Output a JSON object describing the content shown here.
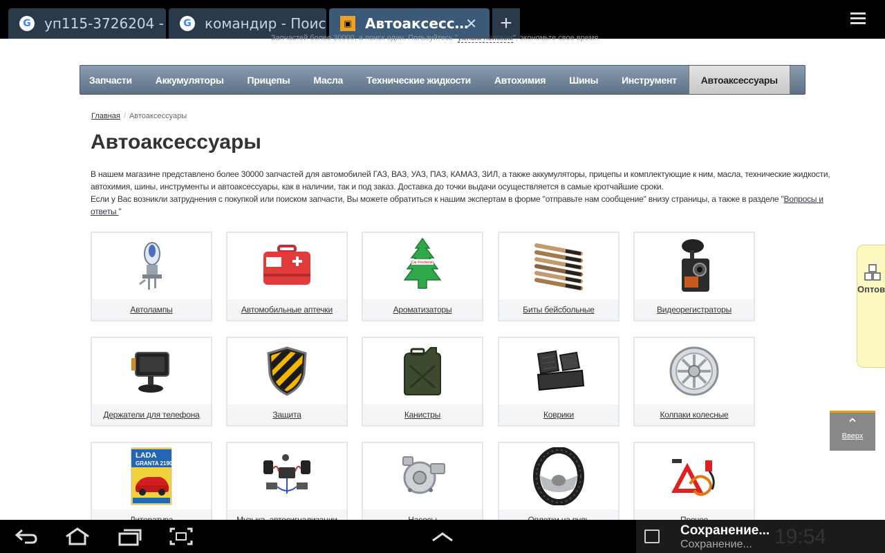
{
  "browser": {
    "tabs": [
      {
        "title": "уп115-3726204 - …",
        "icon": "google-icon"
      },
      {
        "title": "командир - Поис…",
        "icon": "google-icon"
      },
      {
        "title": "Автоаксесс…",
        "icon": "site-icon",
        "active": true
      }
    ],
    "new_tab": "+",
    "close": "✕"
  },
  "notice": {
    "text": "Запчастей более 30000, а поиск один. Пользуйтесь \"",
    "link": "умным поиском",
    "tail": "\", экономьте свое время."
  },
  "nav": {
    "items": [
      "Запчасти",
      "Аккумуляторы",
      "Прицепы",
      "Масла",
      "Технические жидкости",
      "Автохимия",
      "Шины",
      "Инструмент",
      "Автоаксессуары"
    ],
    "active_index": 8
  },
  "breadcrumb": {
    "home": "Главная",
    "sep": "/",
    "current": "Автоаксессуары"
  },
  "page": {
    "title": "Автоаксессуары",
    "desc_line1": "В нашем магазине представлено более 30000 запчастей для автомобилей ГАЗ, ВАЗ, УАЗ, ПАЗ, КАМАЗ, ЗИЛ, а также аккумуляторы, прицепы и комплектующие к ним, масла, технические жидкости, автохимия, шины, инструменты и автоаксессуары, как в наличии, так и под заказ. Доставка до точки выдачи осуществляется в самые кротчайшие сроки.",
    "desc_line2": "Если у Вас возникли затруднения с покупкой или поиском запчасти, Вы можете обратиться к нашим экспертам в форме \"отправьте нам сообщение\" внизу страницы, а также в разделе \"",
    "desc_link": "Вопросы и ответы ",
    "desc_tail": "\""
  },
  "categories": [
    {
      "label": "Автолампы",
      "icon": "car-bulb-icon"
    },
    {
      "label": "Автомобильные аптечки",
      "icon": "first-aid-kit-icon"
    },
    {
      "label": "Ароматизаторы",
      "icon": "air-freshener-icon"
    },
    {
      "label": "Биты бейсбольные",
      "icon": "baseball-bats-icon"
    },
    {
      "label": "Видеорегистраторы",
      "icon": "dashcam-icon"
    },
    {
      "label": "Держатели для телефона",
      "icon": "phone-holder-icon"
    },
    {
      "label": "Защита",
      "icon": "shield-icon"
    },
    {
      "label": "Канистры",
      "icon": "jerrycan-icon"
    },
    {
      "label": "Коврики",
      "icon": "car-mats-icon"
    },
    {
      "label": "Колпаки колесные",
      "icon": "hubcap-icon"
    },
    {
      "label": "Литература",
      "icon": "book-icon"
    },
    {
      "label": "Музыка, автосигнализации",
      "icon": "car-alarm-icon"
    },
    {
      "label": "Насосы",
      "icon": "pump-icon"
    },
    {
      "label": "Оплетки на руль",
      "icon": "steering-cover-icon"
    },
    {
      "label": "Прочее",
      "icon": "misc-icon"
    }
  ],
  "book_cover": {
    "line1": "LADA",
    "line2": "GRANTA 2190"
  },
  "freshener_text": "Car-Freshener",
  "side": {
    "opt_label": "Оптов",
    "up_label": "Вверх"
  },
  "system": {
    "notif_title": "Сохранение...",
    "notif_sub": "Сохранение...",
    "clock": "19:54"
  }
}
